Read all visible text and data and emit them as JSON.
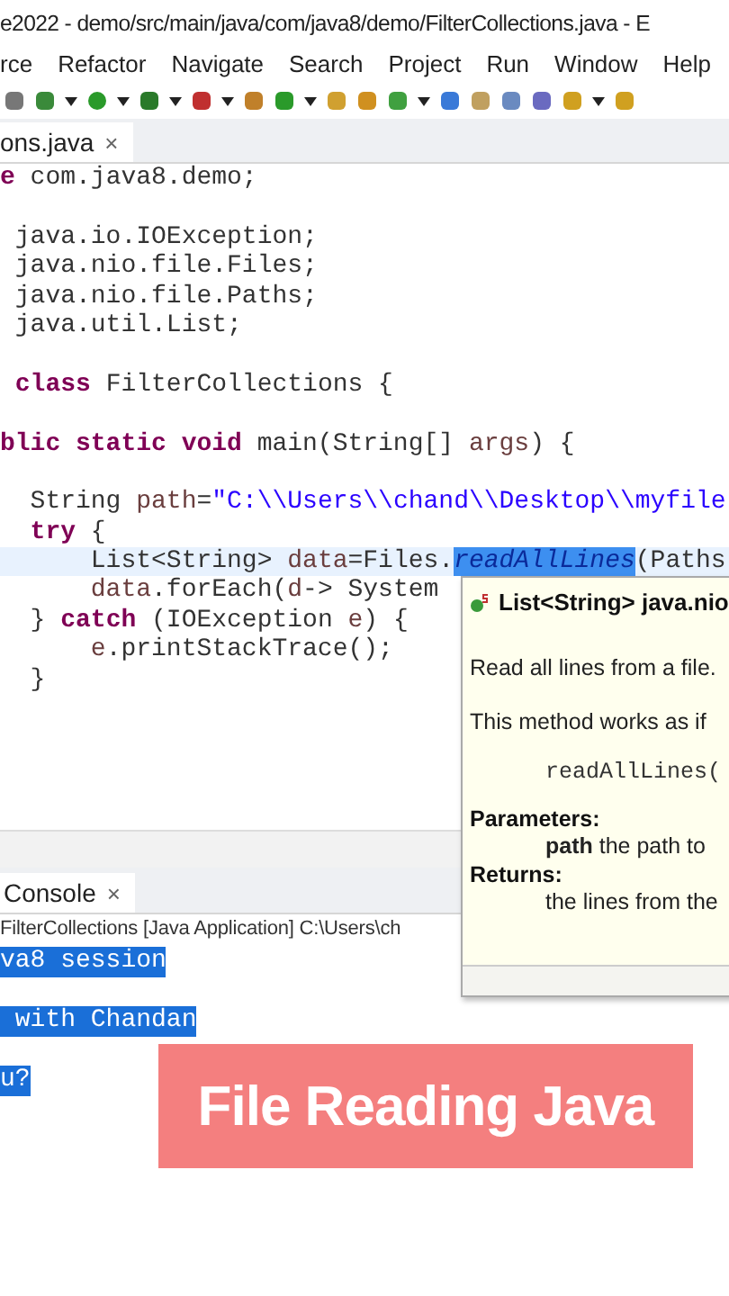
{
  "window": {
    "title": "e2022 - demo/src/main/java/com/java8/demo/FilterCollections.java - E"
  },
  "menu": [
    "rce",
    "Refactor",
    "Navigate",
    "Search",
    "Project",
    "Run",
    "Window",
    "Help"
  ],
  "editor_tabs": [
    {
      "label": "ons.java",
      "close": "×",
      "selected": true
    }
  ],
  "code_lines": [
    {
      "kind": "code",
      "current": false,
      "segments": [
        {
          "kind": "keyword",
          "text": "e"
        },
        {
          "kind": "plain",
          "text": " com.java8.demo;"
        }
      ]
    },
    {
      "kind": "blank"
    },
    {
      "kind": "code",
      "current": false,
      "segments": [
        {
          "kind": "plain",
          "text": " java.io.IOException;"
        }
      ]
    },
    {
      "kind": "code",
      "current": false,
      "segments": [
        {
          "kind": "plain",
          "text": " java.nio.file.Files;"
        }
      ]
    },
    {
      "kind": "code",
      "current": false,
      "segments": [
        {
          "kind": "plain",
          "text": " java.nio.file.Paths;"
        }
      ]
    },
    {
      "kind": "code",
      "current": false,
      "segments": [
        {
          "kind": "plain",
          "text": " java.util.List;"
        }
      ]
    },
    {
      "kind": "blank"
    },
    {
      "kind": "code",
      "current": false,
      "segments": [
        {
          "kind": "keyword",
          "text": " class"
        },
        {
          "kind": "plain",
          "text": " FilterCollections {"
        }
      ]
    },
    {
      "kind": "blank"
    },
    {
      "kind": "code",
      "current": false,
      "segments": [
        {
          "kind": "keyword",
          "text": "blic static void"
        },
        {
          "kind": "plain",
          "text": " main(String[] "
        },
        {
          "kind": "param",
          "text": "args"
        },
        {
          "kind": "plain",
          "text": ") {"
        }
      ]
    },
    {
      "kind": "blank"
    },
    {
      "kind": "code",
      "current": false,
      "segments": [
        {
          "kind": "plain",
          "text": "  String "
        },
        {
          "kind": "param",
          "text": "path"
        },
        {
          "kind": "plain",
          "text": "="
        },
        {
          "kind": "string",
          "text": "\"C:\\\\Users\\\\chand\\\\Desktop\\\\myfile"
        }
      ]
    },
    {
      "kind": "code",
      "current": false,
      "segments": [
        {
          "kind": "keyword",
          "text": "  try"
        },
        {
          "kind": "plain",
          "text": " {"
        }
      ]
    },
    {
      "kind": "code",
      "current": true,
      "segments": [
        {
          "kind": "plain",
          "text": "      List<String> "
        },
        {
          "kind": "param",
          "text": "data"
        },
        {
          "kind": "plain",
          "text": "=Files."
        },
        {
          "kind": "selected",
          "text": "readAllLines"
        },
        {
          "kind": "plain",
          "text": "(Paths"
        }
      ]
    },
    {
      "kind": "code",
      "current": false,
      "segments": [
        {
          "kind": "param",
          "text": "      data"
        },
        {
          "kind": "plain",
          "text": ".forEach("
        },
        {
          "kind": "param",
          "text": "d"
        },
        {
          "kind": "plain",
          "text": "-> System"
        }
      ]
    },
    {
      "kind": "code",
      "current": false,
      "segments": [
        {
          "kind": "plain",
          "text": "  } "
        },
        {
          "kind": "keyword",
          "text": "catch"
        },
        {
          "kind": "plain",
          "text": " (IOException "
        },
        {
          "kind": "param",
          "text": "e"
        },
        {
          "kind": "plain",
          "text": ") {"
        }
      ]
    },
    {
      "kind": "code",
      "current": false,
      "segments": [
        {
          "kind": "param",
          "text": "      e"
        },
        {
          "kind": "plain",
          "text": ".printStackTrace();"
        }
      ]
    },
    {
      "kind": "code",
      "current": false,
      "segments": [
        {
          "kind": "plain",
          "text": "  }"
        }
      ]
    }
  ],
  "hover_popup": {
    "signature": "List<String> java.nio",
    "summary": "Read all lines from a file.",
    "detail": "This method works as if",
    "code": "readAllLines(",
    "parameters_label": "Parameters:",
    "parameter": "**path** the path to",
    "returns_label": "Returns:",
    "returns": "the lines from the"
  },
  "console": {
    "tabs": [
      {
        "label": "Console",
        "close": "×",
        "selected": true
      }
    ],
    "info": "FilterCollections [Java Application] C:\\Users\\ch",
    "lines": [
      {
        "text": "va8 session",
        "selected": true
      },
      {
        "text": " with Chandan",
        "selected": true
      },
      {
        "text": "u?",
        "selected": true
      }
    ]
  },
  "banner": {
    "text": "File Reading Java"
  }
}
